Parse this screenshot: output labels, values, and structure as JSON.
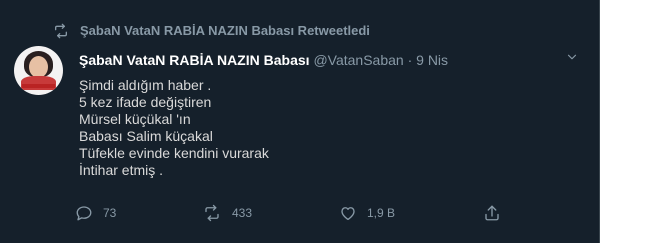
{
  "retweet_context": {
    "text": "ŞabaN VataN RABİA NAZIN Babası Retweetledi",
    "icon": "retweet-icon"
  },
  "tweet": {
    "author_name": "ŞabaN VataN RABİA NAZIN Babası",
    "handle": "@VatanSaban",
    "separator": "·",
    "date": "9 Nis",
    "lines": [
      "Şimdi aldığım haber .",
      "5 kez ifade değiştiren",
      "Mürsel küçükal 'ın",
      "Babası Salim küçakal",
      "Tüfekle evinde kendini vurarak",
      "İntihar etmiş ."
    ]
  },
  "actions": {
    "reply": {
      "icon": "reply-icon",
      "count": "73"
    },
    "retweet": {
      "icon": "retweet-icon",
      "count": "433"
    },
    "like": {
      "icon": "heart-icon",
      "count": "1,9 B"
    },
    "share": {
      "icon": "share-icon"
    }
  },
  "colors": {
    "background": "#15202b",
    "muted": "#8899a6",
    "text": "#d9d9d9",
    "name": "#ffffff"
  }
}
